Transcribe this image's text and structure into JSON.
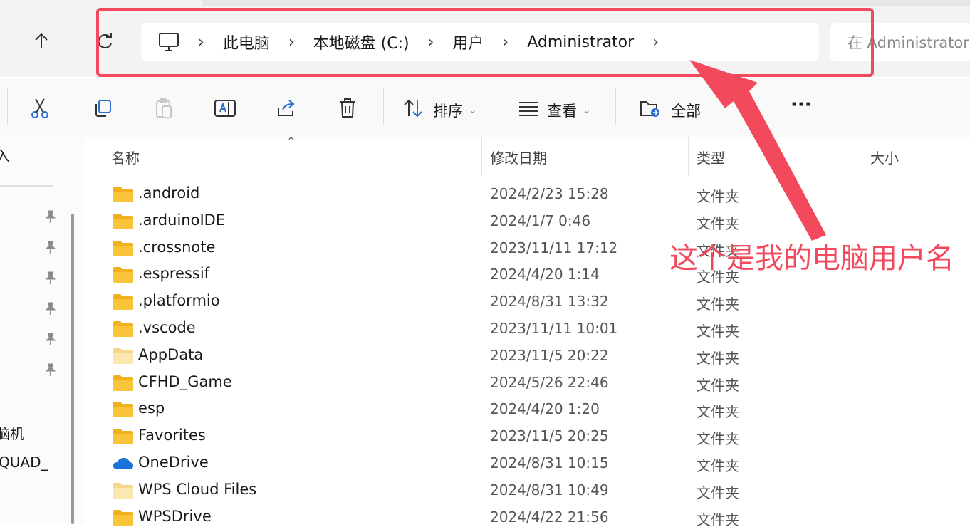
{
  "address_bar": {
    "breadcrumbs": [
      "此电脑",
      "本地磁盘 (C:)",
      "用户",
      "Administrator"
    ],
    "separator": "›",
    "search_placeholder": "在 Administrator"
  },
  "toolbar": {
    "sort_label": "排序",
    "view_label": "查看",
    "select_label": "全部",
    "more_label": "···"
  },
  "sidebar": {
    "top_text": "入",
    "item_this_pc": "脑机",
    "item_quad": "QUAD_"
  },
  "columns": {
    "name": "名称",
    "date": "修改日期",
    "type": "类型",
    "size": "大小"
  },
  "files": [
    {
      "name": ".android",
      "date": "2024/2/23 15:28",
      "type": "文件夹",
      "icon": "folder-icon"
    },
    {
      "name": ".arduinoIDE",
      "date": "2024/1/7 0:46",
      "type": "文件夹",
      "icon": "folder-icon"
    },
    {
      "name": ".crossnote",
      "date": "2023/11/11 17:12",
      "type": "文件夹",
      "icon": "folder-icon"
    },
    {
      "name": ".espressif",
      "date": "2024/4/20 1:14",
      "type": "文件夹",
      "icon": "folder-icon"
    },
    {
      "name": ".platformio",
      "date": "2024/8/31 13:32",
      "type": "文件夹",
      "icon": "folder-icon"
    },
    {
      "name": ".vscode",
      "date": "2023/11/11 10:01",
      "type": "文件夹",
      "icon": "folder-icon"
    },
    {
      "name": "AppData",
      "date": "2023/11/5 20:22",
      "type": "文件夹",
      "icon": "hidden-folder-icon"
    },
    {
      "name": "CFHD_Game",
      "date": "2024/5/26 22:46",
      "type": "文件夹",
      "icon": "folder-icon"
    },
    {
      "name": "esp",
      "date": "2024/4/20 1:20",
      "type": "文件夹",
      "icon": "folder-icon"
    },
    {
      "name": "Favorites",
      "date": "2023/11/5 20:25",
      "type": "文件夹",
      "icon": "folder-icon"
    },
    {
      "name": "OneDrive",
      "date": "2024/8/31 10:15",
      "type": "文件夹",
      "icon": "onedrive-icon"
    },
    {
      "name": "WPS Cloud Files",
      "date": "2024/8/31 10:49",
      "type": "文件夹",
      "icon": "hidden-folder-icon"
    },
    {
      "name": "WPSDrive",
      "date": "2024/4/22 21:56",
      "type": "文件夹",
      "icon": "folder-icon"
    }
  ],
  "annotation": {
    "text": "这个是我的电脑用户名",
    "color": "#f2495c"
  },
  "colors": {
    "folder": "#f8c53a",
    "folder_light": "#fbe3a3",
    "onedrive": "#1a73d9",
    "highlight": "#f2495c"
  }
}
